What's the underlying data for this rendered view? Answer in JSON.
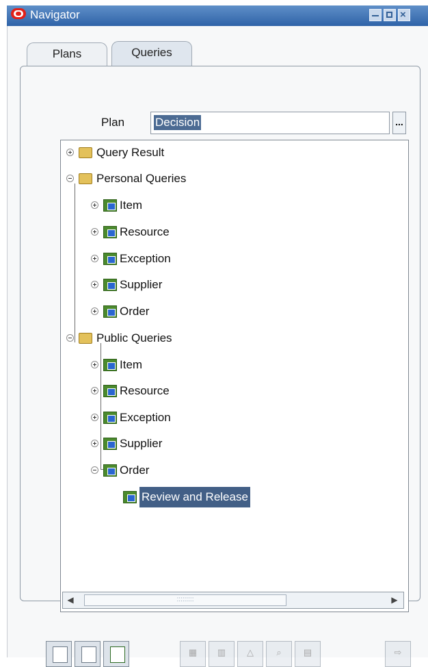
{
  "window": {
    "title": "Navigator"
  },
  "tabs": [
    {
      "label": "Plans"
    },
    {
      "label": "Queries"
    }
  ],
  "plan": {
    "label": "Plan",
    "value": "Decision",
    "lov_label": "..."
  },
  "tree": {
    "query_result": "Query Result",
    "personal_queries": "Personal Queries",
    "personal": [
      "Item",
      "Resource",
      "Exception",
      "Supplier",
      "Order"
    ],
    "public_queries": "Public Queries",
    "public": [
      "Item",
      "Resource",
      "Exception",
      "Supplier",
      "Order"
    ],
    "selected_child": "Review and Release"
  },
  "scrollbar": {
    "left_arrow": "◀",
    "right_arrow": "▶"
  },
  "toolbar": [
    "new-document-icon",
    "open-document-icon",
    "run-query-icon",
    "table-icon",
    "chart-icon",
    "exception-icon",
    "find-icon",
    "form-icon",
    "export-icon"
  ]
}
